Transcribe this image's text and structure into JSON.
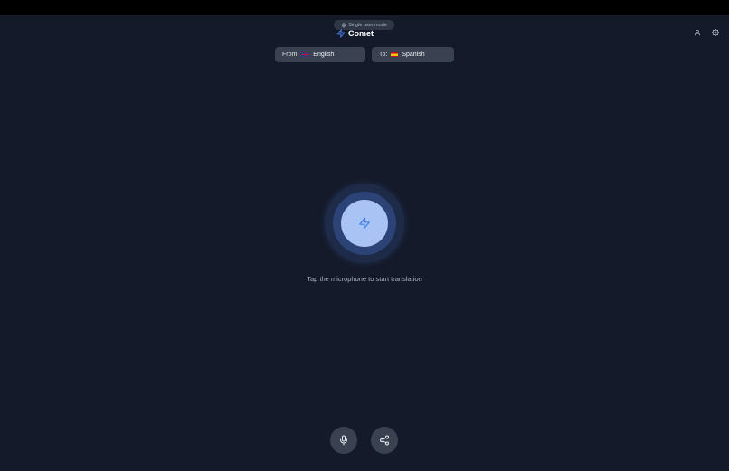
{
  "header": {
    "mode_label": "Single user mode",
    "brand_name": "Comet"
  },
  "languages": {
    "from_prefix": "From:",
    "from_language": "English",
    "from_flag": "flag-uk",
    "to_prefix": "To:",
    "to_language": "Spanish",
    "to_flag": "flag-es"
  },
  "main": {
    "hint": "Tap the microphone to start translation"
  },
  "icons": {
    "mode": "microphone-icon",
    "brand": "lightning-icon",
    "profile": "user-icon",
    "settings": "gear-icon",
    "orb": "lightning-icon",
    "mic_button": "microphone-icon",
    "share_button": "share-icon"
  },
  "colors": {
    "background": "#141a29",
    "accent": "#3f7be8",
    "orb_core": "#a8c4f4",
    "button_bg": "#3a4150"
  }
}
